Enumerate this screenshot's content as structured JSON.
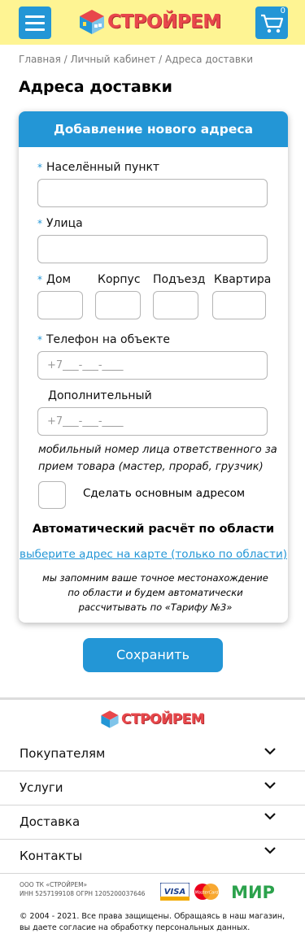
{
  "header": {
    "brand": "СТРОЙРЕМ",
    "cart_count": "0",
    "icons": {
      "menu": "hamburger-menu-icon",
      "cart": "shopping-cart-icon",
      "logo": "house-cube-logo"
    }
  },
  "breadcrumb": "Главная / Личный кабинет / Адреса доставки",
  "page_title": "Адреса доставки",
  "form": {
    "header": "Добавление нового адреса",
    "required_mark": "*",
    "locality_label": "Населённый пункт",
    "locality_value": "",
    "street_label": "Улица",
    "street_value": "",
    "house_label": "Дом",
    "building_label": "Корпус",
    "entrance_label": "Подъезд",
    "apartment_label": "Квартира",
    "phone_label": "Телефон на объекте",
    "phone_placeholder": "+7___-___-____",
    "extra_label": "Дополнительный",
    "extra_placeholder": "+7___-___-____",
    "hint": "мобильный номер лица ответственного за прием товара (мастер, прораб, грузчик)",
    "default_label": "Сделать основным адресом",
    "auto_title": "Автоматический расчёт по области",
    "map_link": "выберите адрес на карте (только по области)",
    "note": "мы запомним ваше точное местонахождение по области и будем автоматически рассчитывать по «Тарифу №3»"
  },
  "save_label": "Сохранить",
  "footer": {
    "brand": "СТРОЙРЕМ",
    "items": [
      "Покупателям",
      "Услуги",
      "Доставка",
      "Контакты"
    ],
    "legal_line1": "ООО ТК «СТРОЙРЕМ»",
    "legal_line2": "ИНН 5257199108 ОГРН 1205200037646",
    "payments": [
      "VISA",
      "MasterCard",
      "МИР"
    ],
    "copyright": "© 2004 - 2021. Все права защищены.  Обращаясь в наш магазин, вы даете  согласие на обработку персональных данных."
  },
  "colors": {
    "accent": "#2396d6",
    "header_bg": "#fef493",
    "brand_red": "#e8474b"
  }
}
